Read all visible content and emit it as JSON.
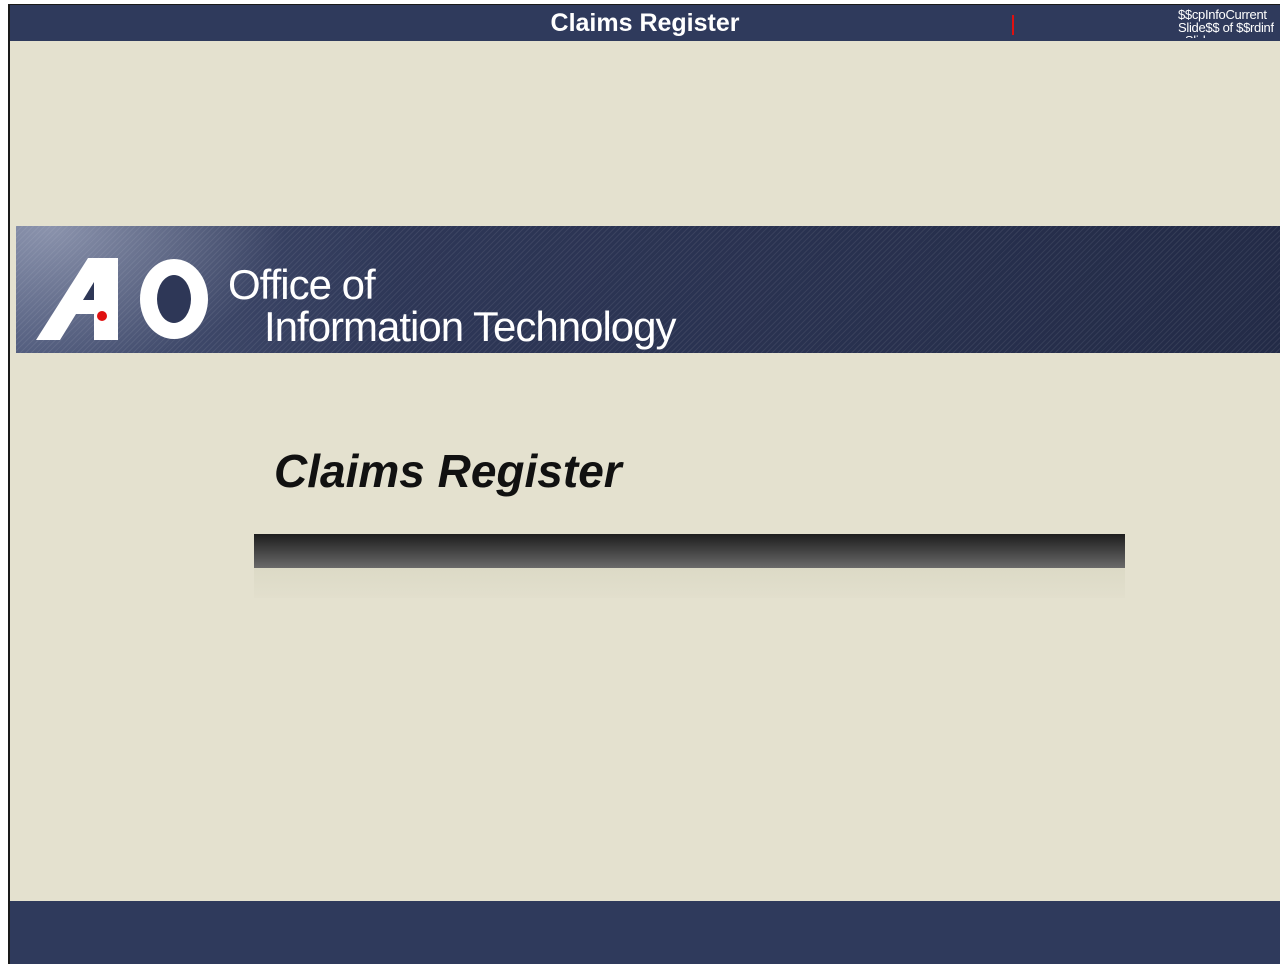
{
  "header": {
    "title": "Claims Register",
    "slide_counter": "$$cpInfoCurrentSlide$$ of $$rdinfoSlide"
  },
  "banner": {
    "logo_text": "AO",
    "org_line1": "Office of",
    "org_line2": "Information  Technology"
  },
  "slide": {
    "title": "Claims Register"
  },
  "colors": {
    "bar": "#2f3a5c",
    "background": "#e4e1cf",
    "accent_red": "#e01010"
  }
}
